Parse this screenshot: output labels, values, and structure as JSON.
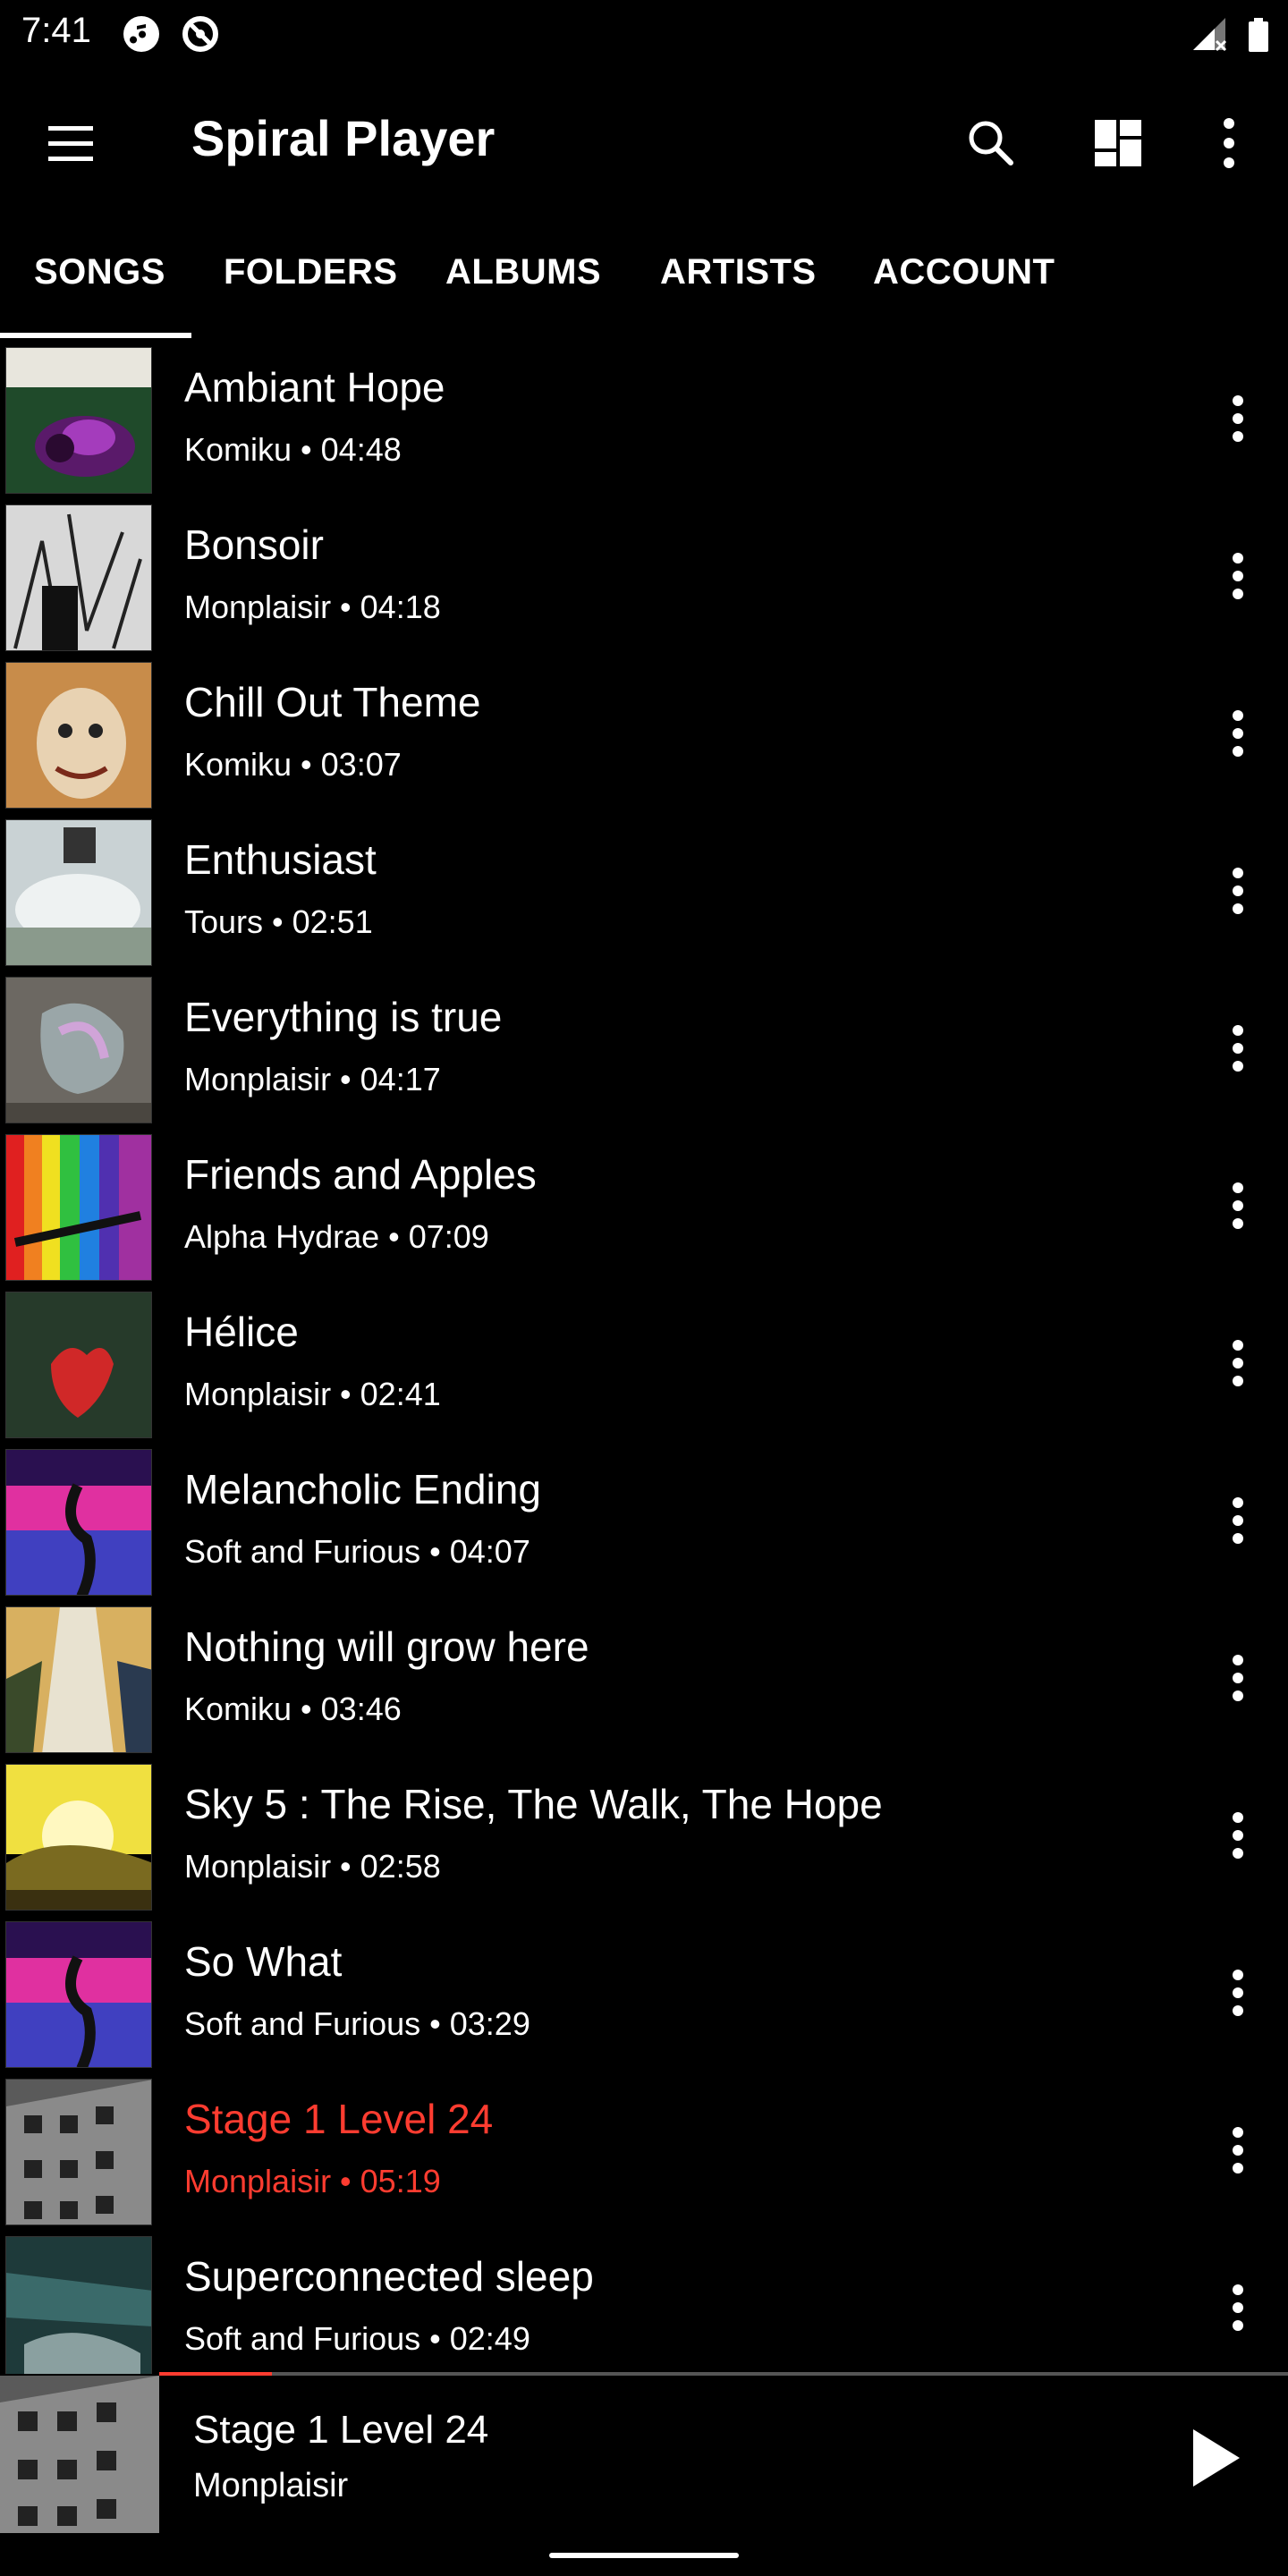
{
  "status_bar": {
    "time": "7:41"
  },
  "app_bar": {
    "title": "Spiral Player"
  },
  "tabs": [
    {
      "label": "SONGS",
      "selected": true
    },
    {
      "label": "FOLDERS"
    },
    {
      "label": "ALBUMS"
    },
    {
      "label": "ARTISTS"
    },
    {
      "label": "ACCOUNT"
    }
  ],
  "songs": [
    {
      "title": "Ambiant Hope",
      "subtitle": "Komiku • 04:48"
    },
    {
      "title": "Bonsoir",
      "subtitle": "Monplaisir • 04:18"
    },
    {
      "title": "Chill Out Theme",
      "subtitle": "Komiku • 03:07"
    },
    {
      "title": "Enthusiast",
      "subtitle": "Tours • 02:51"
    },
    {
      "title": "Everything is true",
      "subtitle": "Monplaisir • 04:17"
    },
    {
      "title": "Friends and Apples",
      "subtitle": "Alpha Hydrae • 07:09"
    },
    {
      "title": "Hélice",
      "subtitle": "Monplaisir • 02:41"
    },
    {
      "title": "Melancholic Ending",
      "subtitle": "Soft and Furious • 04:07"
    },
    {
      "title": "Nothing will grow here",
      "subtitle": "Komiku • 03:46"
    },
    {
      "title": "Sky 5 : The Rise, The Walk, The Hope",
      "subtitle": "Monplaisir • 02:58"
    },
    {
      "title": "So What",
      "subtitle": "Soft and Furious • 03:29"
    },
    {
      "title": "Stage 1 Level 24",
      "subtitle": "Monplaisir • 05:19",
      "playing": true
    },
    {
      "title": "Superconnected sleep",
      "subtitle": "Soft and Furious • 02:49"
    }
  ],
  "now_playing": {
    "title": "Stage 1 Level 24",
    "artist": "Monplaisir",
    "progress_fraction": 0.1
  },
  "icons": {
    "menu": "menu-icon",
    "search": "search-icon",
    "layout": "dashboard-icon",
    "more": "more-vert-icon",
    "play": "play-icon"
  },
  "colors": {
    "background": "#000000",
    "text": "#ffffff",
    "accent": "#ff3c30"
  }
}
